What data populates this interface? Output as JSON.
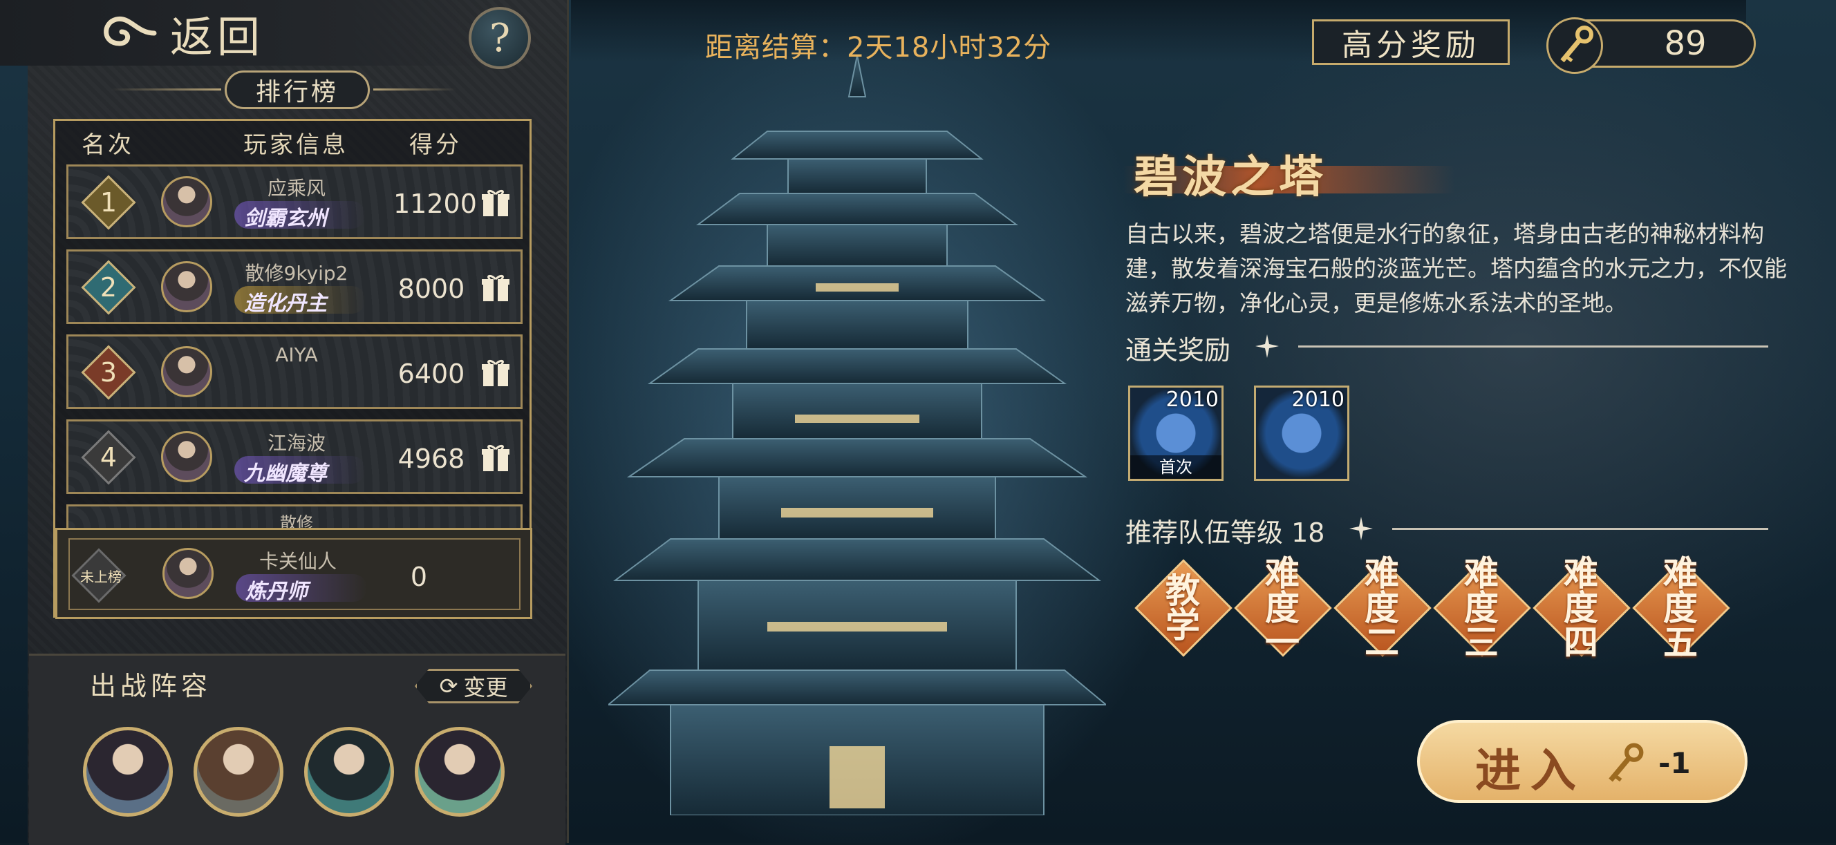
{
  "nav": {
    "back_label": "返回",
    "help_label": "?"
  },
  "leaderboard": {
    "title": "排行榜",
    "headers": {
      "rank": "名次",
      "player": "玩家信息",
      "score": "得分"
    },
    "rows": [
      {
        "rank": "1",
        "name": "应乘风",
        "title": "剑霸玄州",
        "score": "11200",
        "rank_color": "#6b5a2a"
      },
      {
        "rank": "2",
        "name": "散修9kyip2",
        "title": "造化丹主",
        "score": "8000",
        "rank_color": "#2f6b73"
      },
      {
        "rank": "3",
        "name": "AIYA",
        "title": "",
        "score": "6400",
        "rank_color": "#7a3b28"
      },
      {
        "rank": "4",
        "name": "江海波",
        "title": "九幽魔尊",
        "score": "4968",
        "rank_color": "#3a3a3a"
      }
    ],
    "partial_row_name": "散修",
    "me": {
      "rank": "未上榜",
      "name": "卡关仙人",
      "title": "炼丹师",
      "score": "0"
    }
  },
  "lineup": {
    "title": "出战阵容",
    "change_label": "变更",
    "heroes": [
      "hero-1",
      "hero-2",
      "hero-3",
      "hero-4"
    ]
  },
  "header": {
    "timer": "距离结算：2天18小时32分",
    "reward_button": "高分奖励",
    "key_count": "89"
  },
  "tower": {
    "name": "碧波之塔",
    "description": "自古以来，碧波之塔便是水行的象征，塔身由古老的神秘材料构建，散发着深海宝石般的淡蓝光芒。塔内蕴含的水元之力，不仅能滋养万物，净化心灵，更是修炼水系法术的圣地。",
    "clear_reward_title": "通关奖励",
    "rewards": [
      {
        "count": "2010",
        "tag": "首次"
      },
      {
        "count": "2010",
        "tag": ""
      }
    ],
    "recommend_title": "推荐队伍等级 18",
    "difficulties": [
      "教学",
      "难度一",
      "难度二",
      "难度三",
      "难度四",
      "难度五"
    ]
  },
  "enter": {
    "label": "进入",
    "cost": "-1"
  },
  "colors": {
    "gold": "#c7ab6c",
    "accent_orange": "#e89a52",
    "timer": "#e8b25c"
  }
}
